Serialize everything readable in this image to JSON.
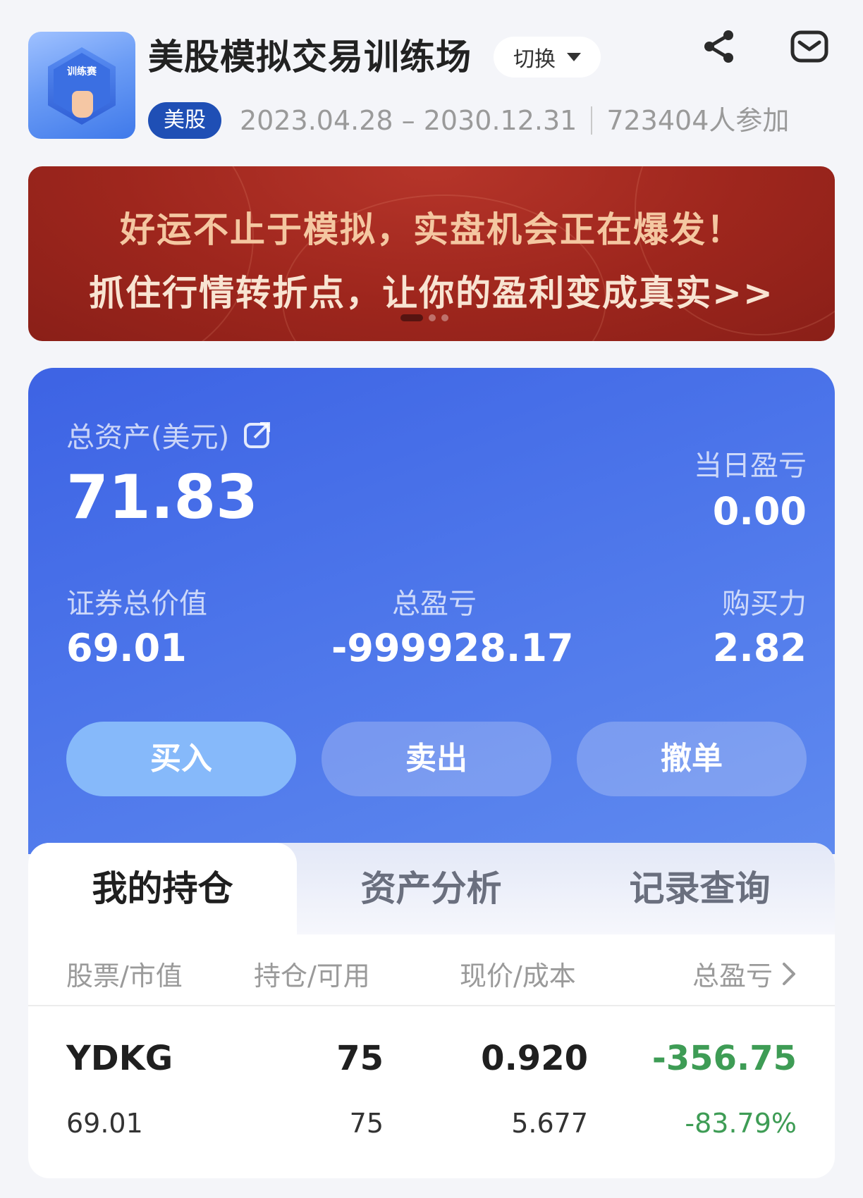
{
  "header": {
    "title": "美股模拟交易训练场",
    "switch_label": "切换",
    "market_badge": "美股",
    "date_range": "2023.04.28 – 2030.12.31",
    "participants": "723404人参加",
    "logo_text": "训练赛"
  },
  "banner": {
    "line1": "好运不止于模拟，实盘机会正在爆发！",
    "line2": "抓住行情转折点，让你的盈利变成真实>>"
  },
  "asset": {
    "total_label": "总资产(美元)",
    "total_value": "71.83",
    "daily_pl_label": "当日盈亏",
    "daily_pl_value": "0.00",
    "securities_label": "证券总价值",
    "securities_value": "69.01",
    "total_pl_label": "总盈亏",
    "total_pl_value": "-999928.17",
    "buying_power_label": "购买力",
    "buying_power_value": "2.82",
    "colors": {
      "card": "#4c75ea",
      "buy_button": "#86b9fa"
    }
  },
  "actions": {
    "buy": "买入",
    "sell": "卖出",
    "cancel": "撤单"
  },
  "tabs": [
    {
      "label": "我的持仓",
      "active": true
    },
    {
      "label": "资产分析",
      "active": false
    },
    {
      "label": "记录查询",
      "active": false
    }
  ],
  "table": {
    "columns": [
      "股票/市值",
      "持仓/可用",
      "现价/成本",
      "总盈亏"
    ],
    "rows": [
      {
        "code": "YDKG",
        "market_value": "69.01",
        "position": "75",
        "available": "75",
        "price": "0.920",
        "cost": "5.677",
        "total_pl": "-356.75",
        "total_pl_pct": "-83.79%"
      }
    ],
    "loss_color": "#3e9c55"
  },
  "icons": [
    "share-icon",
    "mail-icon",
    "external-link-icon",
    "chevron-right-icon",
    "dropdown-triangle-icon"
  ]
}
